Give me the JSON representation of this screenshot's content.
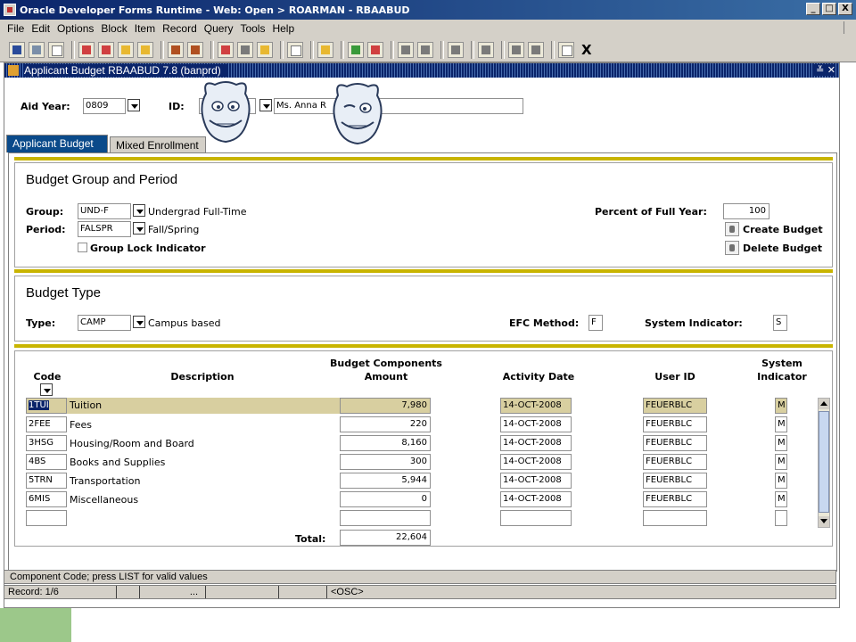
{
  "window": {
    "title": "Oracle Developer Forms Runtime - Web:  Open > ROARMAN - RBAABUD",
    "min": "_",
    "max": "□",
    "close": "X"
  },
  "menu": [
    "File",
    "Edit",
    "Options",
    "Block",
    "Item",
    "Record",
    "Query",
    "Tools",
    "Help"
  ],
  "toolbar": {
    "exit_label": "X"
  },
  "form": {
    "title": "Applicant Budget  RBAABUD  7.8  (banprd)",
    "title_buttons": "≚ ✕",
    "aid_year_label": "Aid Year:",
    "aid_year_value": "0809",
    "id_label": "ID:",
    "name_value": "Ms. Anna R"
  },
  "tabs": {
    "applicant_budget": "Applicant Budget",
    "mixed_enrollment": "Mixed Enrollment"
  },
  "budget_group": {
    "title": "Budget Group and Period",
    "group_label": "Group:",
    "group_value": "UND-F",
    "group_desc": "Undergrad Full-Time",
    "period_label": "Period:",
    "period_value": "FALSPR",
    "period_desc": "Fall/Spring",
    "lock_label": "Group Lock Indicator",
    "percent_label": "Percent of Full Year:",
    "percent_value": "100",
    "create_label": "Create Budget",
    "delete_label": "Delete Budget"
  },
  "budget_type": {
    "title": "Budget Type",
    "type_label": "Type:",
    "type_value": "CAMP",
    "type_desc": "Campus based",
    "efc_label": "EFC Method:",
    "efc_value": "F",
    "sys_label": "System Indicator:",
    "sys_value": "S"
  },
  "components": {
    "headers": {
      "code": "Code",
      "description": "Description",
      "amount_line1": "Budget Components",
      "amount_line2": "Amount",
      "activity_date": "Activity Date",
      "user_id": "User ID",
      "sys_line1": "System",
      "sys_line2": "Indicator"
    },
    "rows": [
      {
        "code": "1TUI",
        "description": "Tuition",
        "amount": "7,980",
        "date": "14-OCT-2008",
        "user": "FEUERBLC",
        "sys": "M"
      },
      {
        "code": "2FEE",
        "description": "Fees",
        "amount": "220",
        "date": "14-OCT-2008",
        "user": "FEUERBLC",
        "sys": "M"
      },
      {
        "code": "3HSG",
        "description": "Housing/Room and Board",
        "amount": "8,160",
        "date": "14-OCT-2008",
        "user": "FEUERBLC",
        "sys": "M"
      },
      {
        "code": "4BS",
        "description": "Books and Supplies",
        "amount": "300",
        "date": "14-OCT-2008",
        "user": "FEUERBLC",
        "sys": "M"
      },
      {
        "code": "5TRN",
        "description": "Transportation",
        "amount": "5,944",
        "date": "14-OCT-2008",
        "user": "FEUERBLC",
        "sys": "M"
      },
      {
        "code": "6MIS",
        "description": "Miscellaneous",
        "amount": "0",
        "date": "14-OCT-2008",
        "user": "FEUERBLC",
        "sys": "M"
      }
    ],
    "total_label": "Total:",
    "total_value": "22,604"
  },
  "status": {
    "message": "Component Code; press LIST for valid values",
    "record": "Record: 1/6",
    "ellipsis": "...",
    "osc": "<OSC>"
  },
  "colors": {
    "title_blue": "#0a246a",
    "gold": "#c8b400",
    "chrome": "#d4d0c8",
    "selected_row": "#d8cfa0"
  }
}
